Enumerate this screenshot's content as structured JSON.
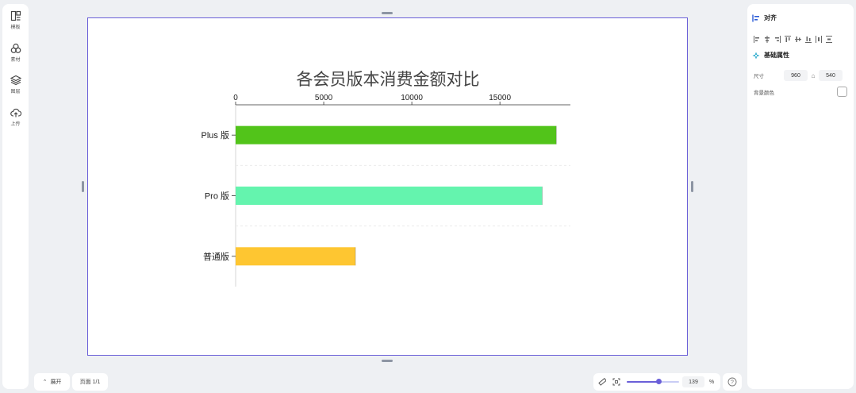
{
  "left_rail": {
    "items": [
      {
        "icon": "template-icon",
        "label": "模板"
      },
      {
        "icon": "material-icon",
        "label": "素材"
      },
      {
        "icon": "layers-icon",
        "label": "图层"
      },
      {
        "icon": "upload-icon",
        "label": "上传"
      }
    ]
  },
  "right_panel": {
    "align_title": "对齐",
    "basic_title": "基础属性",
    "size_label": "尺寸",
    "width": "960",
    "height": "540",
    "bg_color_label": "背景颜色"
  },
  "bottom_bar": {
    "expand_label": "展开",
    "page_label": "页面 1/1",
    "zoom_value": "139",
    "zoom_unit": "%",
    "zoom_fraction": 0.62
  },
  "chart_data": {
    "type": "bar",
    "orientation": "horizontal",
    "title": "各会员版本消费金额对比",
    "categories": [
      "Plus 版",
      "Pro 版",
      "普通版"
    ],
    "values": [
      18200,
      17400,
      6800
    ],
    "colors": [
      "#52c41a",
      "#64f4ae",
      "#fec631"
    ],
    "xlim": [
      0,
      19000
    ],
    "xticks": [
      0,
      5000,
      10000,
      15000
    ],
    "xtick_labels": [
      "0",
      "5000",
      "10000",
      "15000"
    ],
    "x_axis_position": "top",
    "grid": "dashed horizontal separators",
    "legend": "none"
  }
}
